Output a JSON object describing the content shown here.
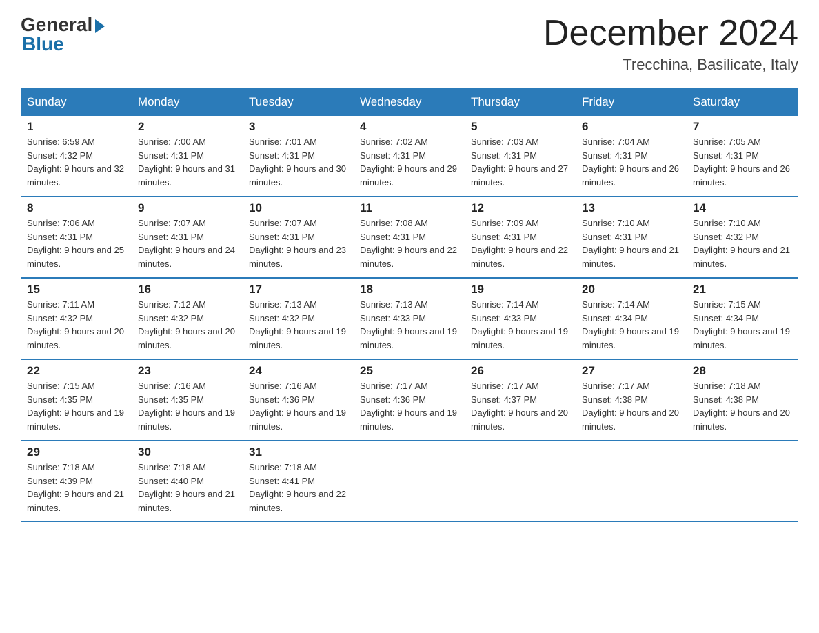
{
  "logo": {
    "general": "General",
    "blue": "Blue"
  },
  "header": {
    "month_year": "December 2024",
    "location": "Trecchina, Basilicate, Italy"
  },
  "weekdays": [
    "Sunday",
    "Monday",
    "Tuesday",
    "Wednesday",
    "Thursday",
    "Friday",
    "Saturday"
  ],
  "weeks": [
    [
      {
        "day": "1",
        "sunrise": "6:59 AM",
        "sunset": "4:32 PM",
        "daylight": "9 hours and 32 minutes."
      },
      {
        "day": "2",
        "sunrise": "7:00 AM",
        "sunset": "4:31 PM",
        "daylight": "9 hours and 31 minutes."
      },
      {
        "day": "3",
        "sunrise": "7:01 AM",
        "sunset": "4:31 PM",
        "daylight": "9 hours and 30 minutes."
      },
      {
        "day": "4",
        "sunrise": "7:02 AM",
        "sunset": "4:31 PM",
        "daylight": "9 hours and 29 minutes."
      },
      {
        "day": "5",
        "sunrise": "7:03 AM",
        "sunset": "4:31 PM",
        "daylight": "9 hours and 27 minutes."
      },
      {
        "day": "6",
        "sunrise": "7:04 AM",
        "sunset": "4:31 PM",
        "daylight": "9 hours and 26 minutes."
      },
      {
        "day": "7",
        "sunrise": "7:05 AM",
        "sunset": "4:31 PM",
        "daylight": "9 hours and 26 minutes."
      }
    ],
    [
      {
        "day": "8",
        "sunrise": "7:06 AM",
        "sunset": "4:31 PM",
        "daylight": "9 hours and 25 minutes."
      },
      {
        "day": "9",
        "sunrise": "7:07 AM",
        "sunset": "4:31 PM",
        "daylight": "9 hours and 24 minutes."
      },
      {
        "day": "10",
        "sunrise": "7:07 AM",
        "sunset": "4:31 PM",
        "daylight": "9 hours and 23 minutes."
      },
      {
        "day": "11",
        "sunrise": "7:08 AM",
        "sunset": "4:31 PM",
        "daylight": "9 hours and 22 minutes."
      },
      {
        "day": "12",
        "sunrise": "7:09 AM",
        "sunset": "4:31 PM",
        "daylight": "9 hours and 22 minutes."
      },
      {
        "day": "13",
        "sunrise": "7:10 AM",
        "sunset": "4:31 PM",
        "daylight": "9 hours and 21 minutes."
      },
      {
        "day": "14",
        "sunrise": "7:10 AM",
        "sunset": "4:32 PM",
        "daylight": "9 hours and 21 minutes."
      }
    ],
    [
      {
        "day": "15",
        "sunrise": "7:11 AM",
        "sunset": "4:32 PM",
        "daylight": "9 hours and 20 minutes."
      },
      {
        "day": "16",
        "sunrise": "7:12 AM",
        "sunset": "4:32 PM",
        "daylight": "9 hours and 20 minutes."
      },
      {
        "day": "17",
        "sunrise": "7:13 AM",
        "sunset": "4:32 PM",
        "daylight": "9 hours and 19 minutes."
      },
      {
        "day": "18",
        "sunrise": "7:13 AM",
        "sunset": "4:33 PM",
        "daylight": "9 hours and 19 minutes."
      },
      {
        "day": "19",
        "sunrise": "7:14 AM",
        "sunset": "4:33 PM",
        "daylight": "9 hours and 19 minutes."
      },
      {
        "day": "20",
        "sunrise": "7:14 AM",
        "sunset": "4:34 PM",
        "daylight": "9 hours and 19 minutes."
      },
      {
        "day": "21",
        "sunrise": "7:15 AM",
        "sunset": "4:34 PM",
        "daylight": "9 hours and 19 minutes."
      }
    ],
    [
      {
        "day": "22",
        "sunrise": "7:15 AM",
        "sunset": "4:35 PM",
        "daylight": "9 hours and 19 minutes."
      },
      {
        "day": "23",
        "sunrise": "7:16 AM",
        "sunset": "4:35 PM",
        "daylight": "9 hours and 19 minutes."
      },
      {
        "day": "24",
        "sunrise": "7:16 AM",
        "sunset": "4:36 PM",
        "daylight": "9 hours and 19 minutes."
      },
      {
        "day": "25",
        "sunrise": "7:17 AM",
        "sunset": "4:36 PM",
        "daylight": "9 hours and 19 minutes."
      },
      {
        "day": "26",
        "sunrise": "7:17 AM",
        "sunset": "4:37 PM",
        "daylight": "9 hours and 20 minutes."
      },
      {
        "day": "27",
        "sunrise": "7:17 AM",
        "sunset": "4:38 PM",
        "daylight": "9 hours and 20 minutes."
      },
      {
        "day": "28",
        "sunrise": "7:18 AM",
        "sunset": "4:38 PM",
        "daylight": "9 hours and 20 minutes."
      }
    ],
    [
      {
        "day": "29",
        "sunrise": "7:18 AM",
        "sunset": "4:39 PM",
        "daylight": "9 hours and 21 minutes."
      },
      {
        "day": "30",
        "sunrise": "7:18 AM",
        "sunset": "4:40 PM",
        "daylight": "9 hours and 21 minutes."
      },
      {
        "day": "31",
        "sunrise": "7:18 AM",
        "sunset": "4:41 PM",
        "daylight": "9 hours and 22 minutes."
      },
      null,
      null,
      null,
      null
    ]
  ]
}
